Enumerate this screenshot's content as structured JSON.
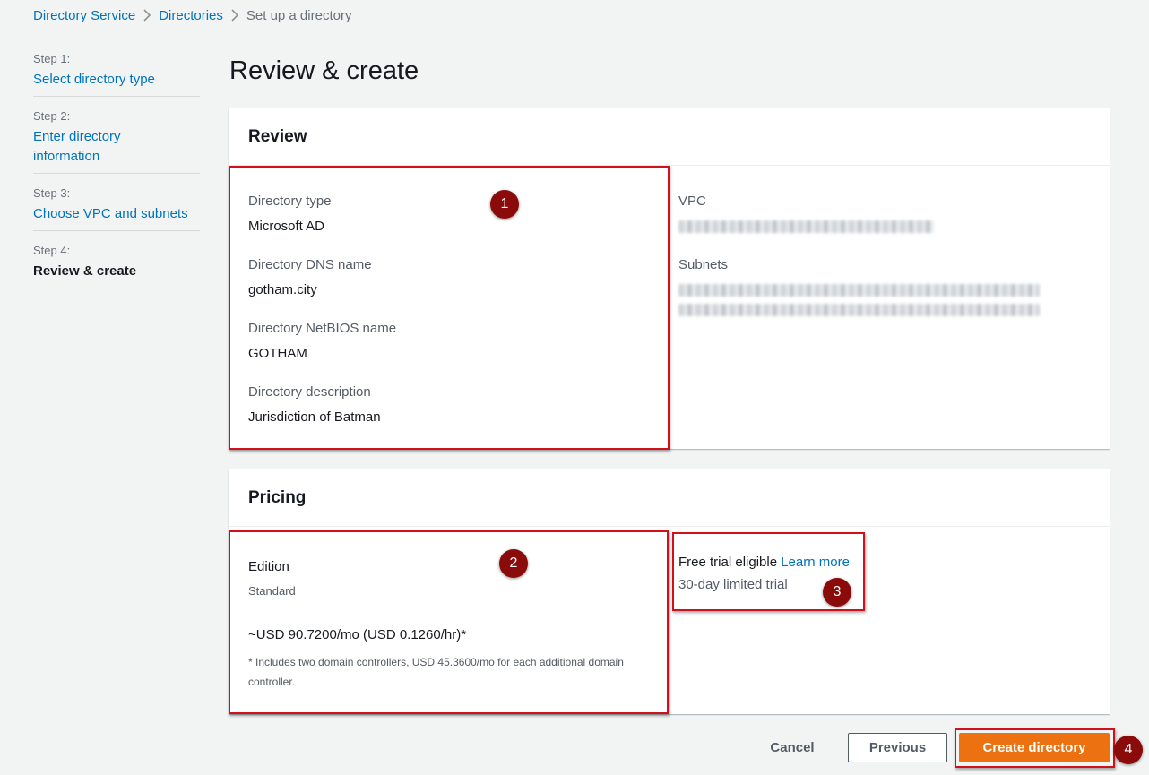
{
  "breadcrumb": {
    "items": [
      "Directory Service",
      "Directories"
    ],
    "current": "Set up a directory"
  },
  "sidenav": {
    "steps": [
      {
        "num": "Step 1:",
        "label": "Select directory type"
      },
      {
        "num": "Step 2:",
        "label": "Enter directory information"
      },
      {
        "num": "Step 3:",
        "label": "Choose VPC and subnets"
      },
      {
        "num": "Step 4:",
        "label": "Review & create"
      }
    ]
  },
  "page_title": "Review & create",
  "review": {
    "header": "Review",
    "fields": [
      {
        "label": "Directory type",
        "value": "Microsoft AD"
      },
      {
        "label": "Directory DNS name",
        "value": "gotham.city"
      },
      {
        "label": "Directory NetBIOS name",
        "value": "GOTHAM"
      },
      {
        "label": "Directory description",
        "value": "Jurisdiction of Batman"
      }
    ],
    "vpc_label": "VPC",
    "subnets_label": "Subnets"
  },
  "pricing": {
    "header": "Pricing",
    "edition_label": "Edition",
    "edition_value": "Standard",
    "price": "~USD 90.7200/mo (USD 0.1260/hr)*",
    "footnote": "* Includes two domain controllers, USD 45.3600/mo for each additional domain controller.",
    "free_trial": "Free trial eligible",
    "learn_more": "Learn more",
    "trial_duration": "30-day limited trial"
  },
  "badges": [
    "1",
    "2",
    "3",
    "4"
  ],
  "footer": {
    "cancel": "Cancel",
    "previous": "Previous",
    "create": "Create directory"
  },
  "colors": {
    "link": "#0073bb",
    "primary_button": "#ec7211",
    "highlight": "#d0101b",
    "badge": "#8b0a0a"
  }
}
